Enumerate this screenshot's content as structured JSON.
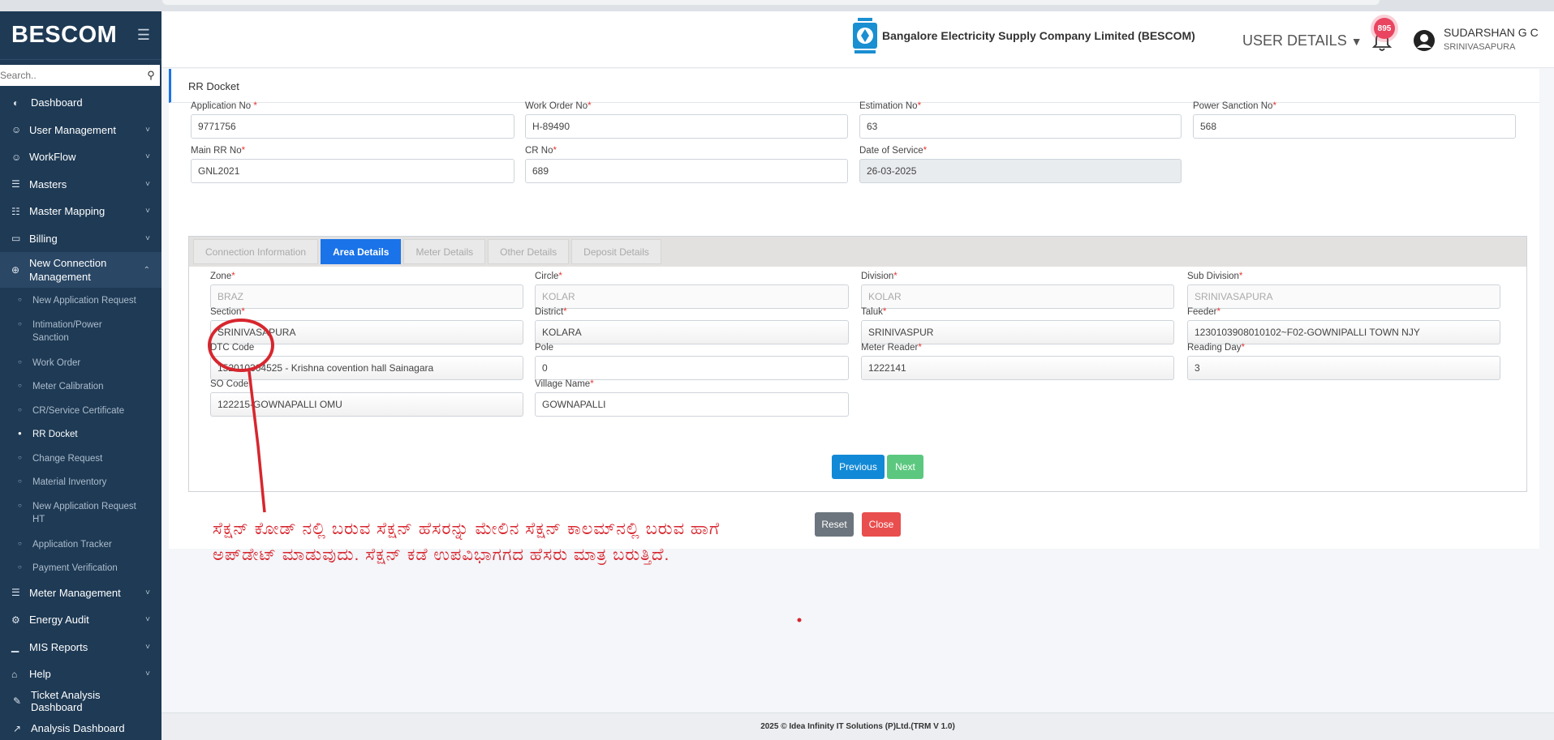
{
  "sidebar": {
    "brand": "BESCOM",
    "search_placeholder": "Search..",
    "items_top": [
      {
        "label": "Dashboard",
        "icon": "dashboard-icon",
        "chevron": false
      },
      {
        "label": "User Management",
        "icon": "user-icon",
        "chevron": true
      },
      {
        "label": "WorkFlow",
        "icon": "user-icon",
        "chevron": true
      },
      {
        "label": "Masters",
        "icon": "list-icon",
        "chevron": true
      },
      {
        "label": "Master Mapping",
        "icon": "sitemap-icon",
        "chevron": true
      },
      {
        "label": "Billing",
        "icon": "monitor-icon",
        "chevron": true
      }
    ],
    "open_item": {
      "label": "New Connection Management",
      "icon": "plus-circle-icon"
    },
    "sub_items": [
      "New Application Request",
      "Intimation/Power Sanction",
      "Work Order",
      "Meter Calibration",
      "CR/Service Certificate",
      "RR Docket",
      "Change Request",
      "Material Inventory",
      "New Application Request HT",
      "Application Tracker",
      "Payment Verification"
    ],
    "active_sub": "RR Docket",
    "items_bottom": [
      {
        "label": "Meter Management",
        "icon": "list-icon",
        "chevron": true
      },
      {
        "label": "Energy Audit",
        "icon": "gears-icon",
        "chevron": true
      },
      {
        "label": "MIS Reports",
        "icon": "bar-chart-icon",
        "chevron": true
      },
      {
        "label": "Help",
        "icon": "home-icon",
        "chevron": true
      },
      {
        "label": "Ticket Analysis Dashboard",
        "icon": "pencil-icon",
        "chevron": false
      },
      {
        "label": "Analysis Dashboard",
        "icon": "line-chart-icon",
        "chevron": false
      }
    ]
  },
  "header": {
    "company_name": "Bangalore Electricity Supply Company Limited (BESCOM)",
    "user_details_label": "USER DETAILS",
    "notification_count": "895",
    "user_name": "SUDARSHAN G C",
    "user_location": "SRINIVASAPURA"
  },
  "page": {
    "title": "RR Docket",
    "top_fields": [
      {
        "label": "Application No",
        "required": " *",
        "value": "9771756",
        "gray": false
      },
      {
        "label": "Work Order No",
        "required": "*",
        "value": "H-89490",
        "gray": false
      },
      {
        "label": "Estimation No",
        "required": "*",
        "value": "63",
        "gray": false
      },
      {
        "label": "Power Sanction No",
        "required": "*",
        "value": "568",
        "gray": false
      },
      {
        "label": "Main RR No",
        "required": "*",
        "value": "GNL2021",
        "gray": false
      },
      {
        "label": "CR No",
        "required": "*",
        "value": "689",
        "gray": false
      },
      {
        "label": "Date of Service",
        "required": "*",
        "value": "26-03-2025",
        "gray": true
      }
    ],
    "tabs": [
      {
        "label": "Connection Information",
        "active": false
      },
      {
        "label": "Area Details",
        "active": true
      },
      {
        "label": "Meter Details",
        "active": false
      },
      {
        "label": "Other Details",
        "active": false
      },
      {
        "label": "Deposit Details",
        "active": false
      }
    ],
    "area_fields": [
      {
        "label": "Zone",
        "required": "*",
        "value": "BRAZ",
        "style": "disabled"
      },
      {
        "label": "Circle",
        "required": "*",
        "value": "KOLAR",
        "style": "disabled"
      },
      {
        "label": "Division",
        "required": "*",
        "value": "KOLAR",
        "style": "disabled"
      },
      {
        "label": "Sub Division",
        "required": "*",
        "value": "SRINIVASAPURA",
        "style": "disabled"
      },
      {
        "label": "Section",
        "required": "*",
        "value": "SRINIVASAPURA",
        "style": "soft"
      },
      {
        "label": "District",
        "required": "*",
        "value": "KOLARA",
        "style": "soft"
      },
      {
        "label": "Taluk",
        "required": "*",
        "value": "SRINIVASPUR",
        "style": "soft"
      },
      {
        "label": "Feeder",
        "required": "*",
        "value": "1230103908010102~F02-GOWNIPALLI TOWN NJY",
        "style": "soft"
      },
      {
        "label": "DTC Code",
        "required": "",
        "value": "152010304525 - Krishna covention hall Sainagara",
        "style": "soft"
      },
      {
        "label": "Pole",
        "required": "",
        "value": "0",
        "style": "plain"
      },
      {
        "label": "Meter Reader",
        "required": "*",
        "value": "1222141",
        "style": "soft"
      },
      {
        "label": "Reading Day",
        "required": "*",
        "value": "3",
        "style": "soft"
      },
      {
        "label": "SO Code",
        "required": "*",
        "value": "122215-GOWNAPALLI OMU",
        "style": "soft"
      },
      {
        "label": "Village Name",
        "required": "*",
        "value": "GOWNAPALLI",
        "style": "plain"
      }
    ],
    "previous_label": "Previous",
    "next_label": "Next",
    "reset_label": "Reset",
    "close_label": "Close"
  },
  "annotation": {
    "text": "ಸೆಕ್ಷನ್ ಕೋಡ್ ನಲ್ಲಿ ಬರುವ ಸೆಕ್ಷನ್ ಹೆಸರನ್ನು ಮೇಲಿನ ಸೆಕ್ಷನ್ ಕಾಲಮ್‌ನಲ್ಲಿ ಬರುವ ಹಾಗೆ ಅಪ್‌ಡೇಟ್ ಮಾಡುವುದು. ಸೆಕ್ಷನ್ ಕಡೆ ಉಪವಿಭಾಗಗದ ಹೆಸರು ಮಾತ್ರ ಬರುತ್ತಿದೆ.",
    "color": "#d7262e"
  },
  "footer": {
    "text": "2025 © Idea Infinity IT Solutions (P)Ltd.(TRM V 1.0)"
  },
  "colors": {
    "sidebar": "#1e3a55",
    "accent": "#1a73e8",
    "next": "#5cc87f",
    "previous": "#1289d6",
    "close": "#e94e4e",
    "reset": "#6c757d"
  }
}
